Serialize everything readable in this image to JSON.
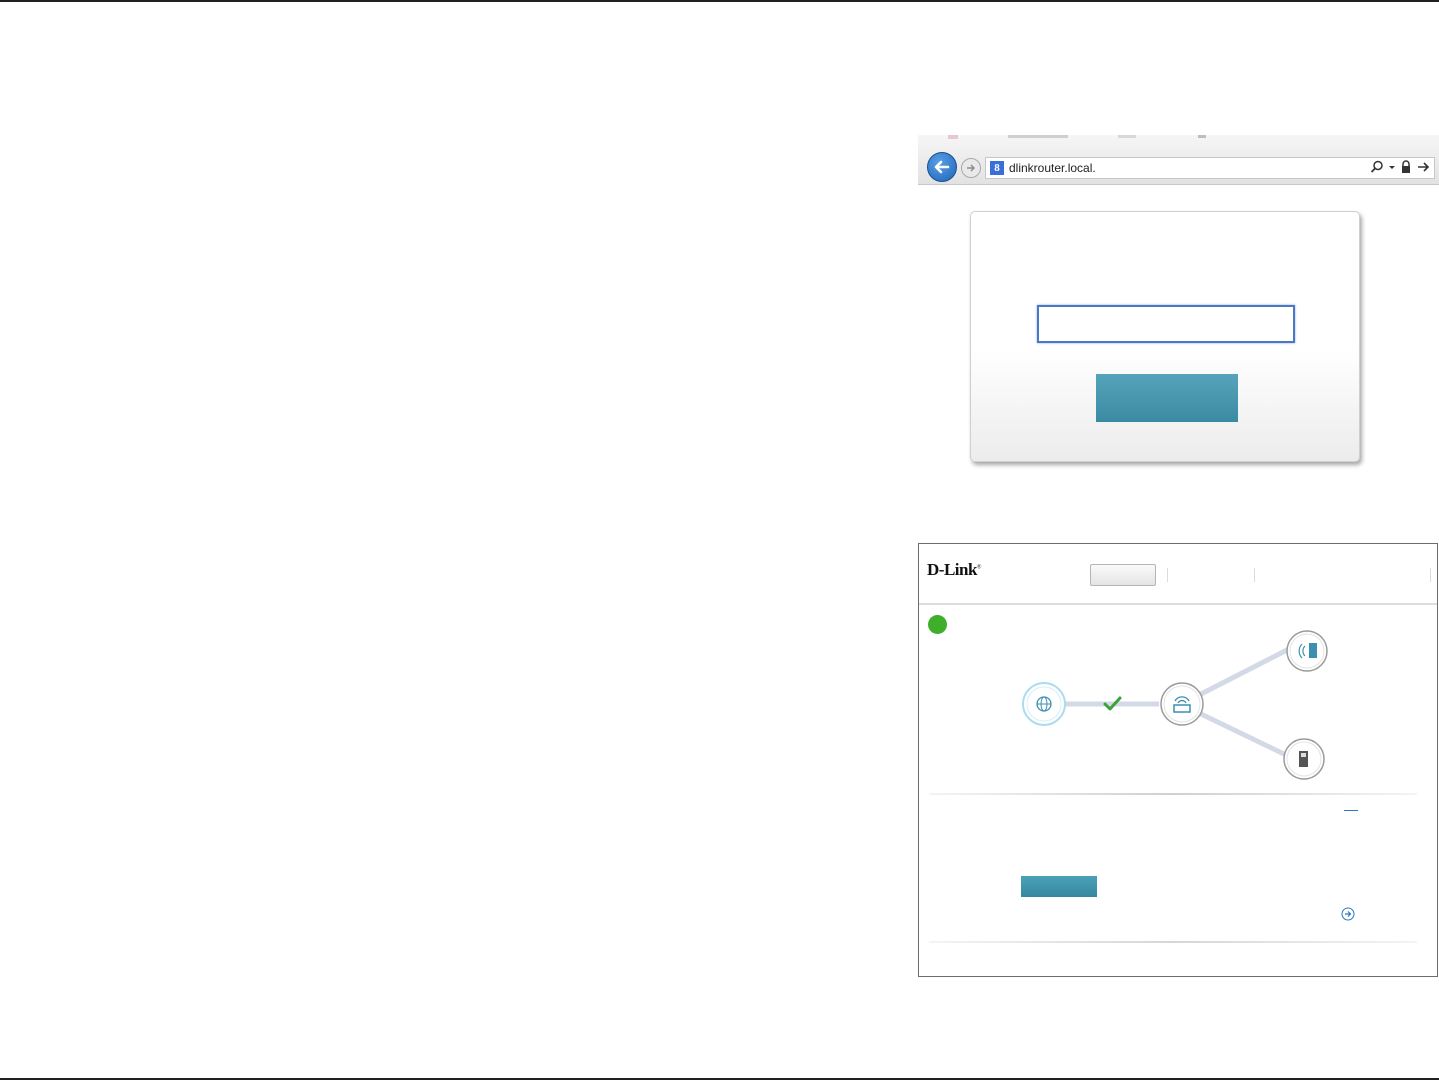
{
  "browser": {
    "url": "dlinkrouter.local.",
    "favicon_letter": "8",
    "icons": [
      "back-arrow-icon",
      "forward-arrow-icon",
      "search-icon",
      "dropdown-icon",
      "lock-icon",
      "go-arrow-icon"
    ]
  },
  "login": {
    "password_value": "",
    "login_label": ""
  },
  "router_ui": {
    "logo": "D-Link",
    "nav": {
      "home_label": "",
      "settings_label": "",
      "management_label": ""
    },
    "status_color": "#3fae2a",
    "network_map": {
      "nodes": [
        "internet-globe-icon",
        "router-icon",
        "wireless-client-icon",
        "usb-device-icon"
      ],
      "connection_status": "connected"
    },
    "action_button_label": "",
    "accent_color": "#4399b1"
  }
}
